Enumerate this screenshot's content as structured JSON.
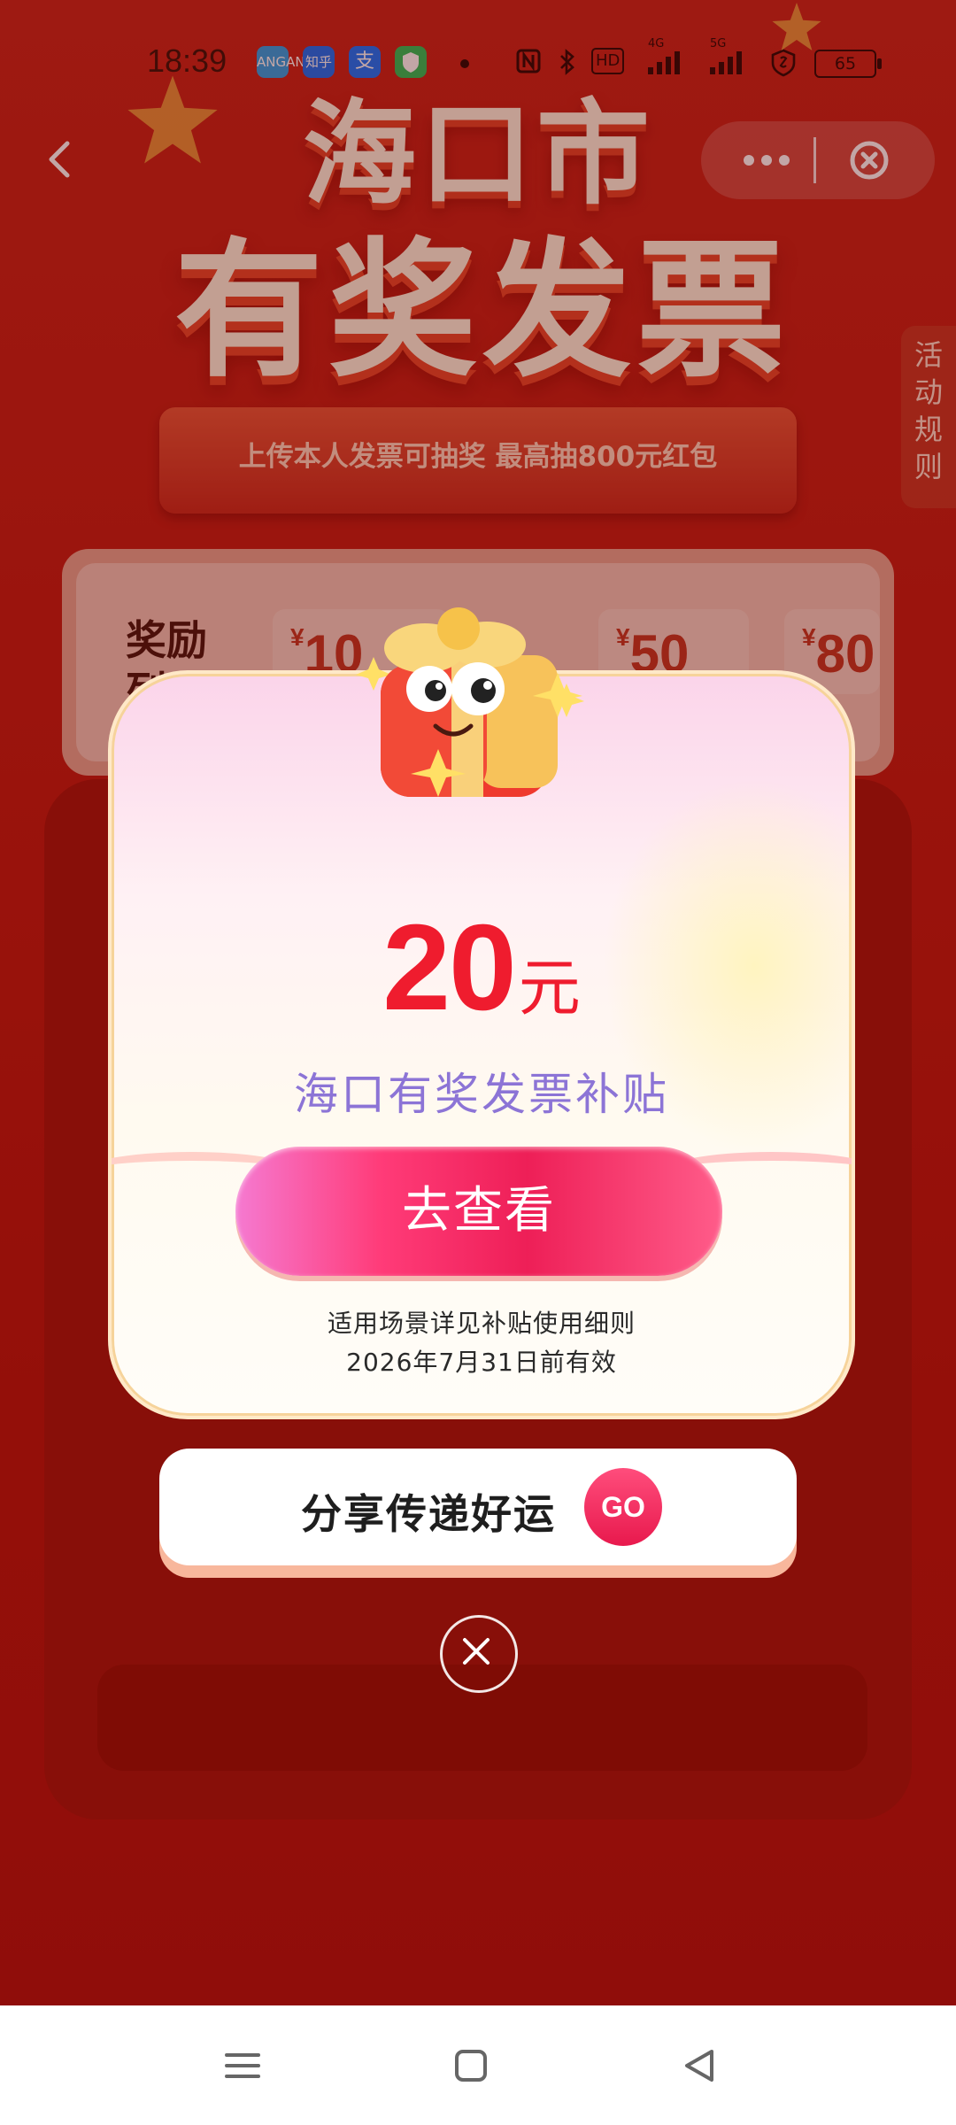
{
  "status_bar": {
    "time": "18:39",
    "apps": [
      {
        "icon": "camel-app-icon",
        "color": "#2fa3e8",
        "label": "ANGAN"
      },
      {
        "icon": "zhihu-icon",
        "color": "#1772f6",
        "label": "知乎"
      },
      {
        "icon": "alipay-icon",
        "color": "#1677ff",
        "label": "支"
      },
      {
        "icon": "shield-app-icon",
        "color": "#2fc25b",
        "label": ""
      }
    ],
    "network_4g": "4G",
    "network_5g": "5G",
    "hd_label": "HD",
    "battery": "65"
  },
  "header": {
    "hero_top": "海口市",
    "hero_main": "有奖发票",
    "ribbon_text": "上传本人发票可抽奖 最高抽800元红包",
    "rules_tab": "活动规则"
  },
  "prize_list": {
    "title": "奖励列表",
    "items": [
      {
        "currency": "¥",
        "value": "10"
      },
      {
        "currency": "¥",
        "value": "50"
      },
      {
        "currency": "¥",
        "value": "80"
      }
    ]
  },
  "popup": {
    "amount": "20",
    "unit": "元",
    "subsidy_name": "海口有奖发票补贴",
    "view_button": "去查看",
    "note_line1": "适用场景详见补贴使用细则",
    "note_line2": "2026年7月31日前有效"
  },
  "share": {
    "label": "分享传递好运",
    "go_button": "GO"
  },
  "colors": {
    "page_red": "#c31f14",
    "amount_red": "#ef1c2e",
    "subsidy_purple": "#8c74d6",
    "button_pink": "#ee1f57"
  }
}
